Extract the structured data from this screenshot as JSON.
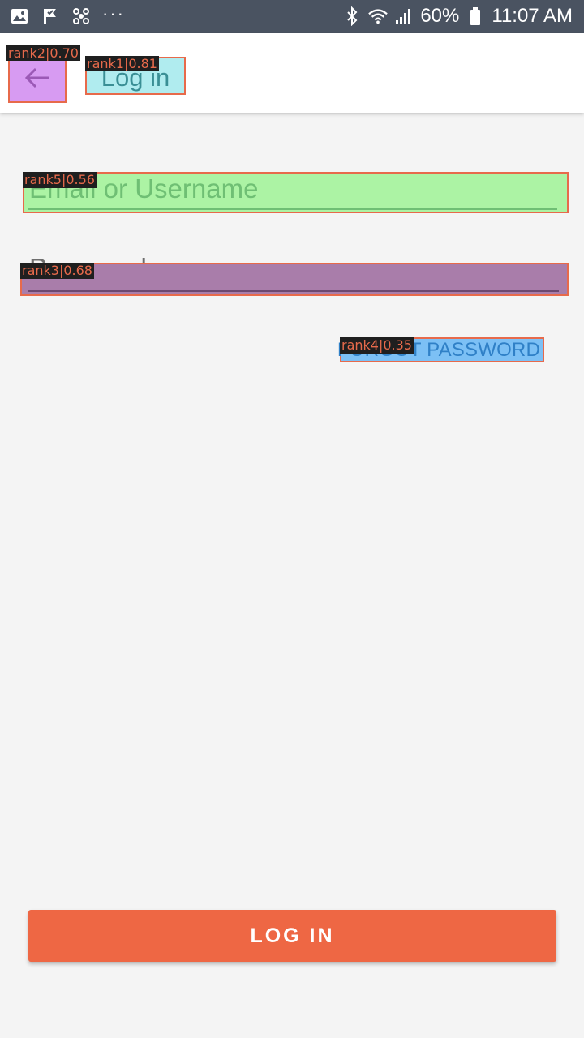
{
  "status_bar": {
    "battery": "60%",
    "time": "11:07 AM",
    "more": "···",
    "icons": [
      "image-icon",
      "flag-check-icon",
      "fan-icon",
      "bluetooth-icon",
      "wifi-icon",
      "signal-icon",
      "battery-icon"
    ]
  },
  "app_bar": {
    "title": "Log in",
    "back_icon": "arrow-back-icon"
  },
  "annotations": {
    "back": "rank2|0.70",
    "title": "rank1|0.81",
    "email": "rank5|0.56",
    "password": "rank3|0.68",
    "forgot": "rank4|0.35"
  },
  "form": {
    "email_placeholder": "Email or Username",
    "password_placeholder": "Password",
    "forgot_label": "FORGOT PASSWORD",
    "login_label": "LOG IN"
  },
  "colors": {
    "accent": "#ee6744",
    "status_bar": "#4a5361",
    "link": "#2f80c7"
  }
}
